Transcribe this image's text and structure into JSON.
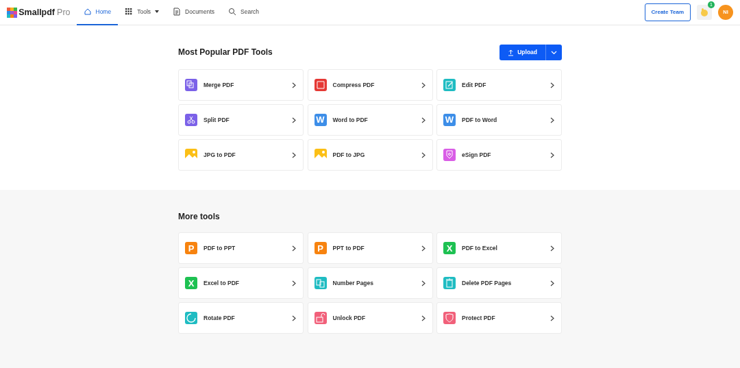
{
  "brand": {
    "name": "Smallpdf",
    "suffix": "Pro"
  },
  "nav": [
    {
      "label": "Home",
      "kind": "home",
      "selected": true
    },
    {
      "label": "Tools",
      "kind": "menu",
      "selected": false
    },
    {
      "label": "Documents",
      "kind": "documents",
      "selected": false
    },
    {
      "label": "Search",
      "kind": "search",
      "selected": false
    }
  ],
  "create_team": "Create Team",
  "notification_count": "1",
  "avatar": "NI",
  "sections": [
    {
      "title": "Most Popular PDF Tools",
      "upload": "Upload",
      "tools": [
        {
          "label": "Merge PDF",
          "kind": "merge",
          "color": "#7b61e8"
        },
        {
          "label": "Compress PDF",
          "kind": "compress",
          "color": "#e53935"
        },
        {
          "label": "Edit PDF",
          "kind": "edit",
          "color": "#1fbcc2"
        },
        {
          "label": "Split PDF",
          "kind": "split",
          "color": "#7b61e8"
        },
        {
          "label": "Word to PDF",
          "kind": "letter",
          "glyph": "W",
          "color": "#3d8ee8"
        },
        {
          "label": "PDF to Word",
          "kind": "letter",
          "glyph": "W",
          "color": "#3d8ee8"
        },
        {
          "label": "JPG to PDF",
          "kind": "image",
          "color": "#fbbf16"
        },
        {
          "label": "PDF to JPG",
          "kind": "image",
          "color": "#fbbf16"
        },
        {
          "label": "eSign PDF",
          "kind": "sign",
          "color": "#d95de6"
        }
      ]
    },
    {
      "title": "More tools",
      "tools": [
        {
          "label": "PDF to PPT",
          "kind": "letter",
          "glyph": "P",
          "color": "#f7830f"
        },
        {
          "label": "PPT to PDF",
          "kind": "letter",
          "glyph": "P",
          "color": "#f7830f"
        },
        {
          "label": "PDF to Excel",
          "kind": "letter",
          "glyph": "X",
          "color": "#1ec152"
        },
        {
          "label": "Excel to PDF",
          "kind": "letter",
          "glyph": "X",
          "color": "#1ec152"
        },
        {
          "label": "Number Pages",
          "kind": "number",
          "color": "#1fbcc2"
        },
        {
          "label": "Delete PDF Pages",
          "kind": "delete",
          "color": "#1fbcc2"
        },
        {
          "label": "Rotate PDF",
          "kind": "rotate",
          "color": "#1fbcc2"
        },
        {
          "label": "Unlock PDF",
          "kind": "unlock",
          "color": "#f1607a"
        },
        {
          "label": "Protect PDF",
          "kind": "protect",
          "color": "#f1607a"
        }
      ]
    }
  ]
}
